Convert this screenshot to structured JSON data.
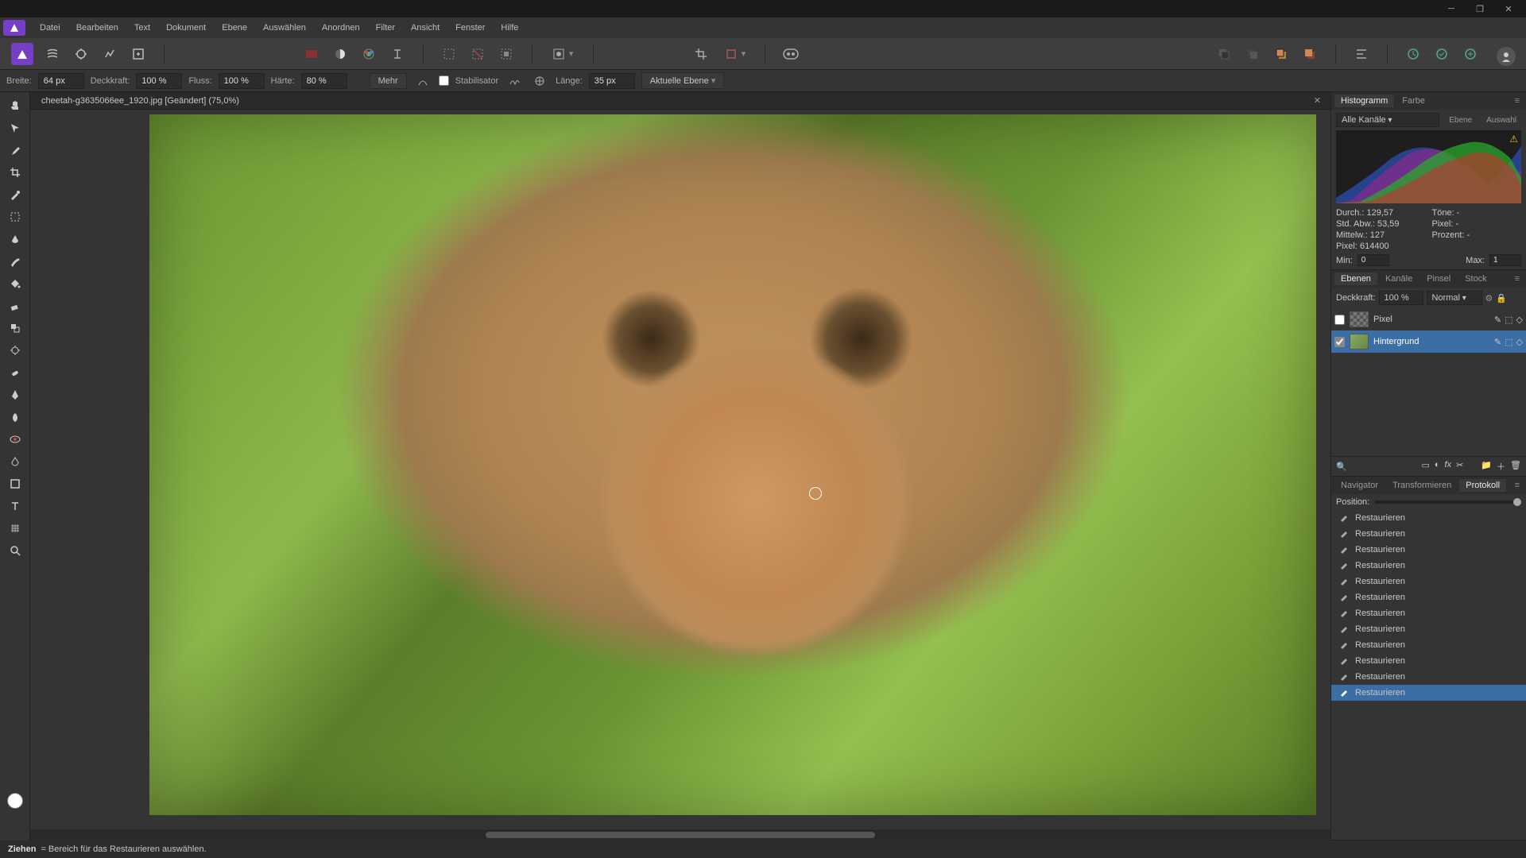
{
  "menubar": [
    "Datei",
    "Bearbeiten",
    "Text",
    "Dokument",
    "Ebene",
    "Auswählen",
    "Anordnen",
    "Filter",
    "Ansicht",
    "Fenster",
    "Hilfe"
  ],
  "context": {
    "breite_label": "Breite:",
    "breite_value": "64 px",
    "deckkraft_label": "Deckkraft:",
    "deckkraft_value": "100 %",
    "fluss_label": "Fluss:",
    "fluss_value": "100 %",
    "harte_label": "Härte:",
    "harte_value": "80 %",
    "mehr": "Mehr",
    "stabilisator": "Stabilisator",
    "lange_label": "Länge:",
    "lange_value": "35 px",
    "ebene_target": "Aktuelle Ebene"
  },
  "doc_tab": "cheetah-g3635066ee_1920.jpg [Geändert] (75,0%)",
  "statusbar": {
    "action": "Ziehen",
    "hint": " = Bereich für das Restaurieren auswählen."
  },
  "panels": {
    "histo_tabs": [
      "Histogramm",
      "Farbe"
    ],
    "histo_channel": "Alle Kanäle",
    "histo_btns": [
      "Ebene",
      "Auswahl"
    ],
    "stats": {
      "durch": "Durch.: 129,57",
      "tone": "Töne: -",
      "stdabw": "Std. Abw.: 53,59",
      "pixelr": "Pixel: -",
      "mittelw": "Mittelw.: 127",
      "prozent": "Prozent: -",
      "pixel": "Pixel: 614400",
      "min_label": "Min:",
      "min_val": "0",
      "max_label": "Max:",
      "max_val": "1"
    },
    "layer_tabs": [
      "Ebenen",
      "Kanäle",
      "Pinsel",
      "Stock"
    ],
    "layer_opacity_label": "Deckkraft:",
    "layer_opacity": "100 %",
    "layer_blend": "Normal",
    "layers": [
      {
        "name": "Pixel",
        "selected": false,
        "checker": true
      },
      {
        "name": "Hintergrund",
        "selected": true,
        "checker": false
      }
    ],
    "nav_tabs": [
      "Navigator",
      "Transformieren",
      "Protokoll"
    ],
    "position_label": "Position:",
    "history": [
      "Restaurieren",
      "Restaurieren",
      "Restaurieren",
      "Restaurieren",
      "Restaurieren",
      "Restaurieren",
      "Restaurieren",
      "Restaurieren",
      "Restaurieren",
      "Restaurieren",
      "Restaurieren",
      "Restaurieren"
    ]
  }
}
